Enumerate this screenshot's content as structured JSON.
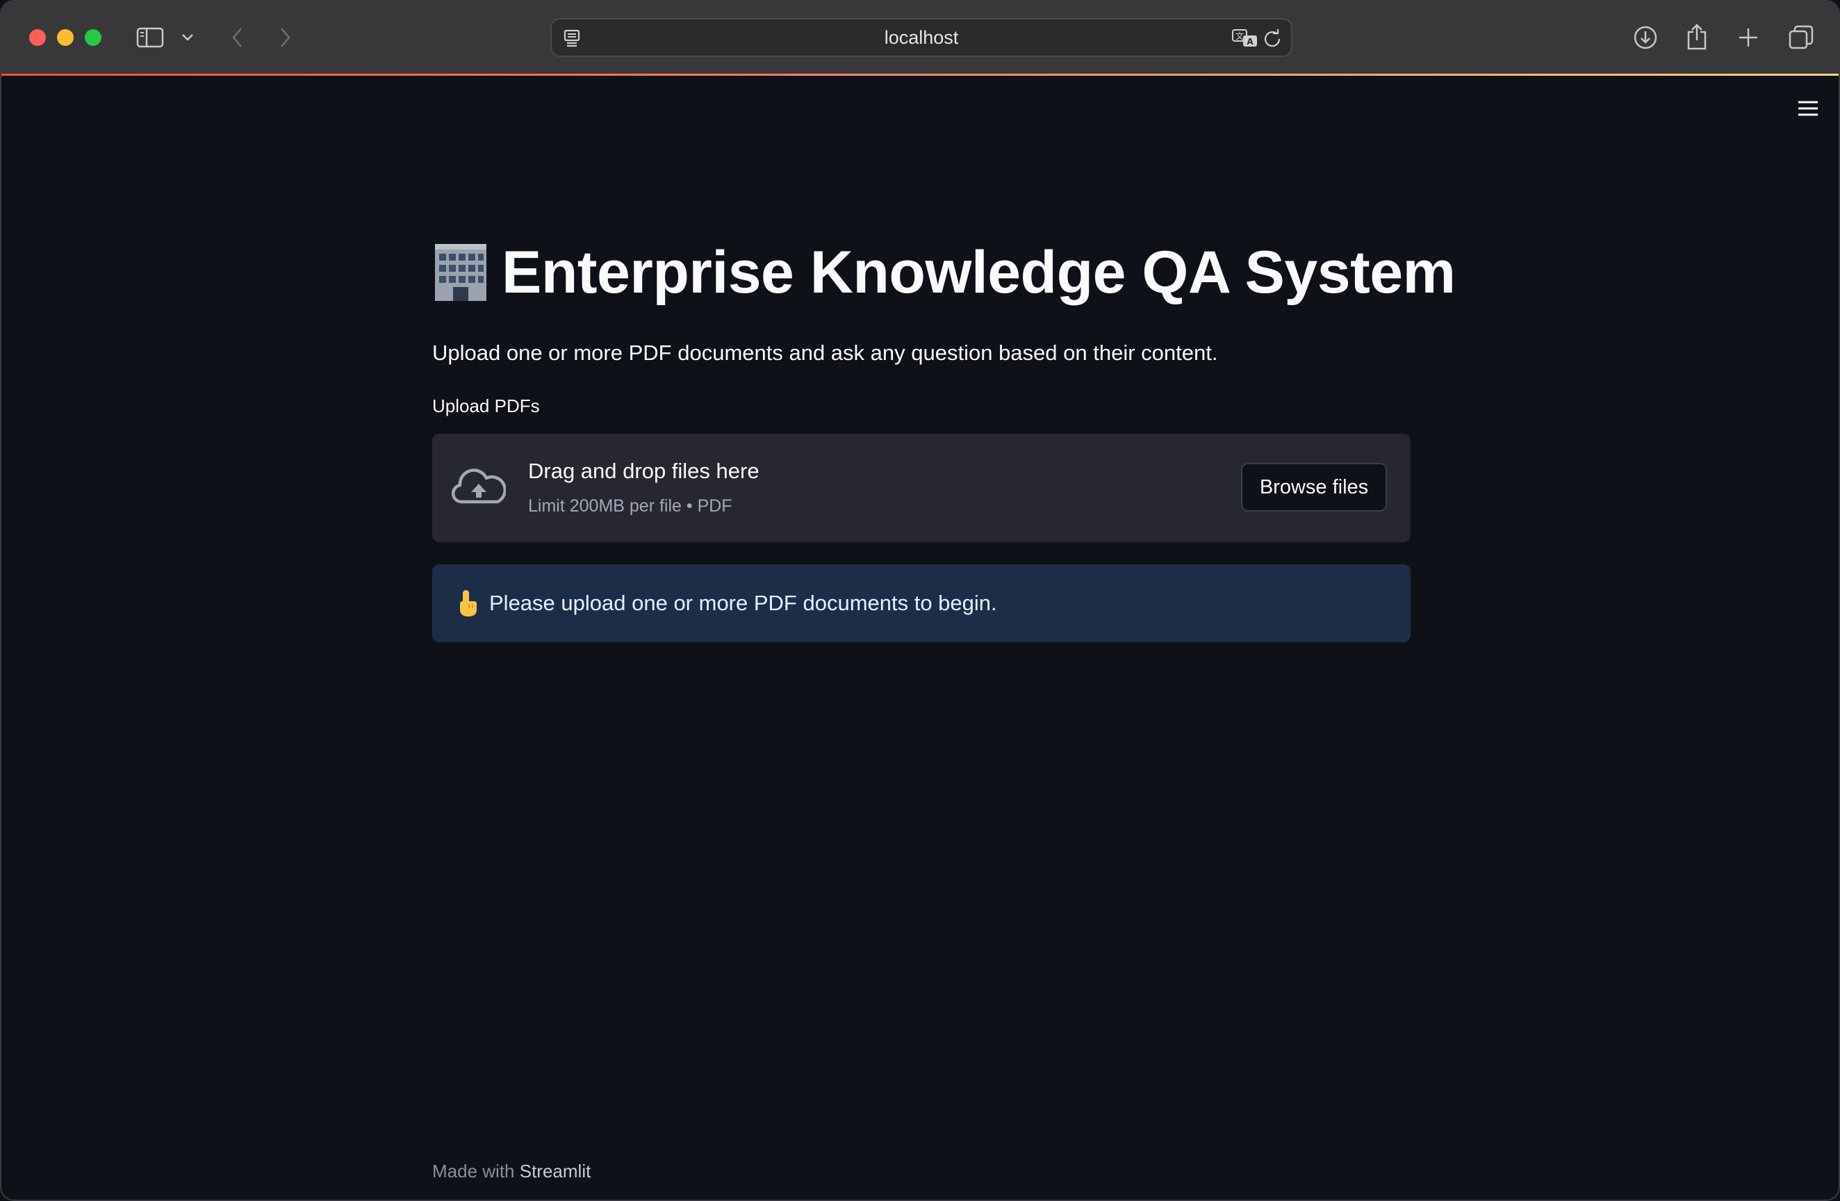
{
  "browser": {
    "url": "localhost",
    "traffic_lights": {
      "close": "#ff5f57",
      "minimize": "#febc2e",
      "zoom": "#28c840"
    },
    "icons": [
      "sidebar-icon",
      "chevron-down-icon",
      "back-icon",
      "forward-icon",
      "page-settings-icon",
      "translate-icon",
      "reload-icon",
      "download-icon",
      "share-icon",
      "new-tab-icon",
      "tab-overview-icon"
    ]
  },
  "app": {
    "menu_icon": "hamburger-menu-icon",
    "title_emoji": "🏢",
    "title": "Enterprise Knowledge QA System",
    "subtitle": "Upload one or more PDF documents and ask any question based on their content.",
    "uploader": {
      "label": "Upload PDFs",
      "drop_text": "Drag and drop files here",
      "limit_text": "Limit 200MB per file • PDF",
      "browse_label": "Browse files",
      "icon": "cloud-upload-icon"
    },
    "info": {
      "emoji": "👆",
      "message": "Please upload one or more PDF documents to begin."
    },
    "footer": {
      "prefix": "Made with",
      "brand": "Streamlit"
    }
  },
  "colors": {
    "background": "#0e1117",
    "dropzone": "#262730",
    "info_bg": "#1c2e47",
    "text": "#fafafa",
    "accent_line": "#ff4b4b"
  }
}
